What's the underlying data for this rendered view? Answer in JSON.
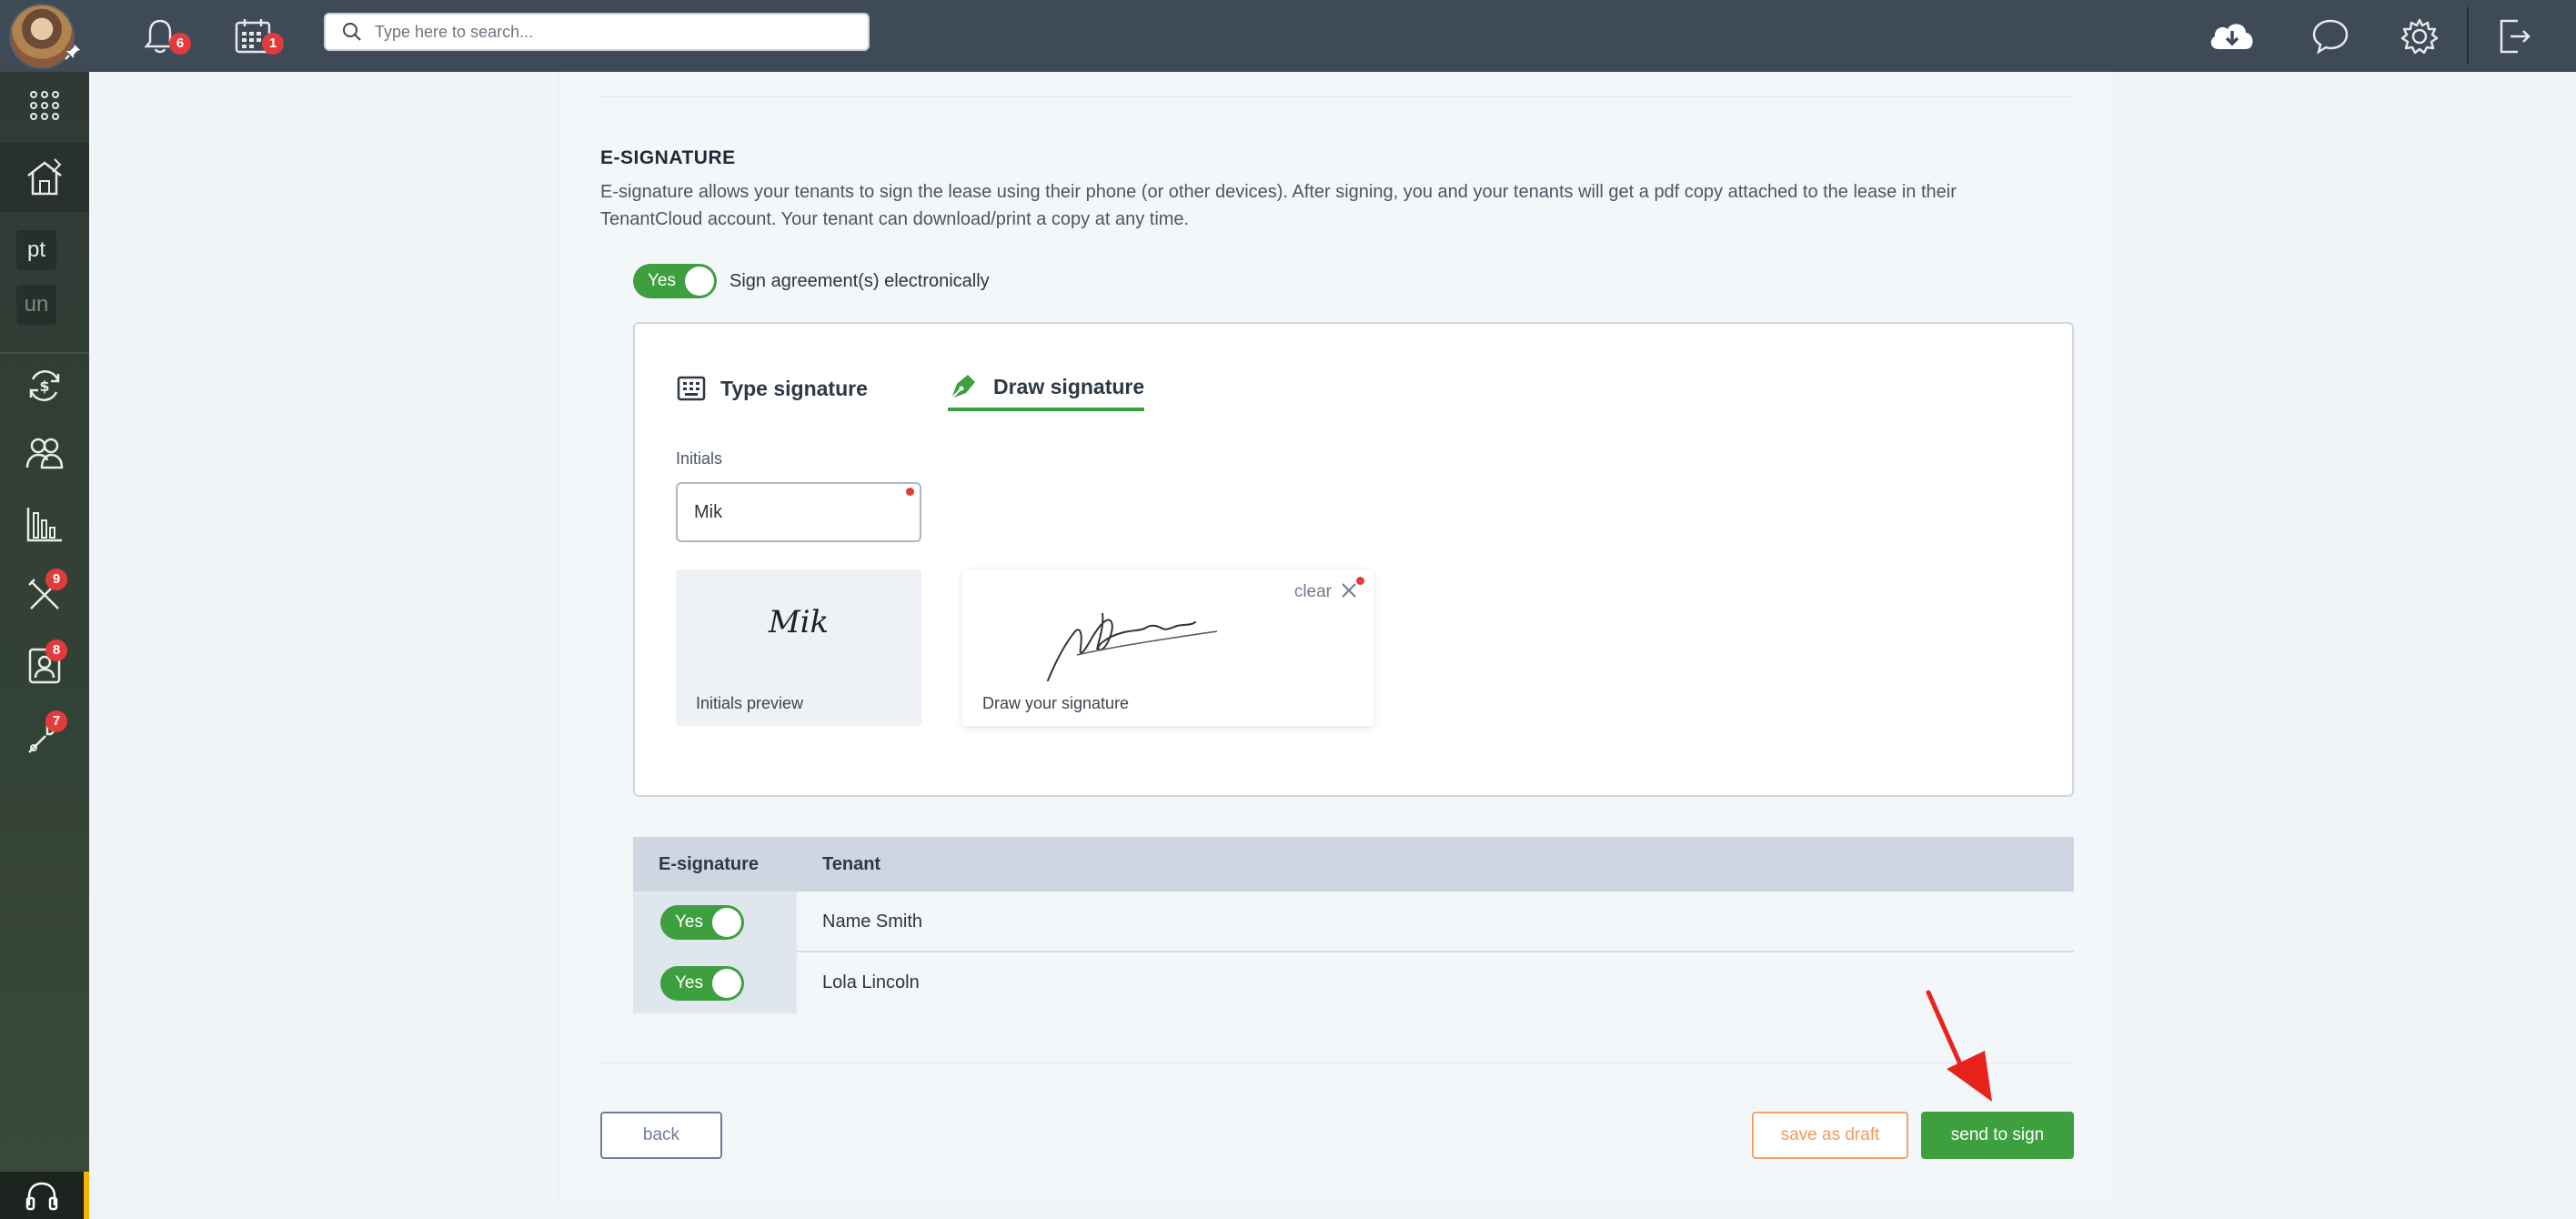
{
  "topbar": {
    "notifications_count": "6",
    "calendar_count": "1",
    "search_placeholder": "Type here to search..."
  },
  "sidebar": {
    "chips": [
      {
        "label": "pt"
      },
      {
        "label": "un"
      }
    ],
    "maintenance_count": "9",
    "applications_count": "8",
    "tools_count": "7"
  },
  "esignature": {
    "title": "E-SIGNATURE",
    "description": "E-signature allows your tenants to sign the lease using their phone (or other devices). After signing, you and your tenants will get a pdf copy attached to the lease in their TenantCloud account. Your tenant can download/print a copy at any time.",
    "toggle_label": "Yes",
    "toggle_text": "Sign agreement(s) electronically",
    "tabs": [
      {
        "label": "Type signature",
        "active": false
      },
      {
        "label": "Draw signature",
        "active": true
      }
    ],
    "initials_label": "Initials",
    "initials_value": "Mik",
    "initials_preview_text": "Mik",
    "initials_preview_caption": "Initials preview",
    "draw_caption": "Draw your signature",
    "clear_label": "clear"
  },
  "table": {
    "headers": [
      "E-signature",
      "Tenant"
    ],
    "rows": [
      {
        "esign": "Yes",
        "tenant": "Name Smith"
      },
      {
        "esign": "Yes",
        "tenant": "Lola Lincoln"
      }
    ]
  },
  "actions": {
    "back": "back",
    "save_draft": "save as draft",
    "send": "send to sign"
  },
  "colors": {
    "topbar": "#3e4a56",
    "accent_green": "#3e9f3f",
    "badge_red": "#e23b3b",
    "draft_orange": "#f09a5c",
    "arrow_red": "#e8231c"
  }
}
